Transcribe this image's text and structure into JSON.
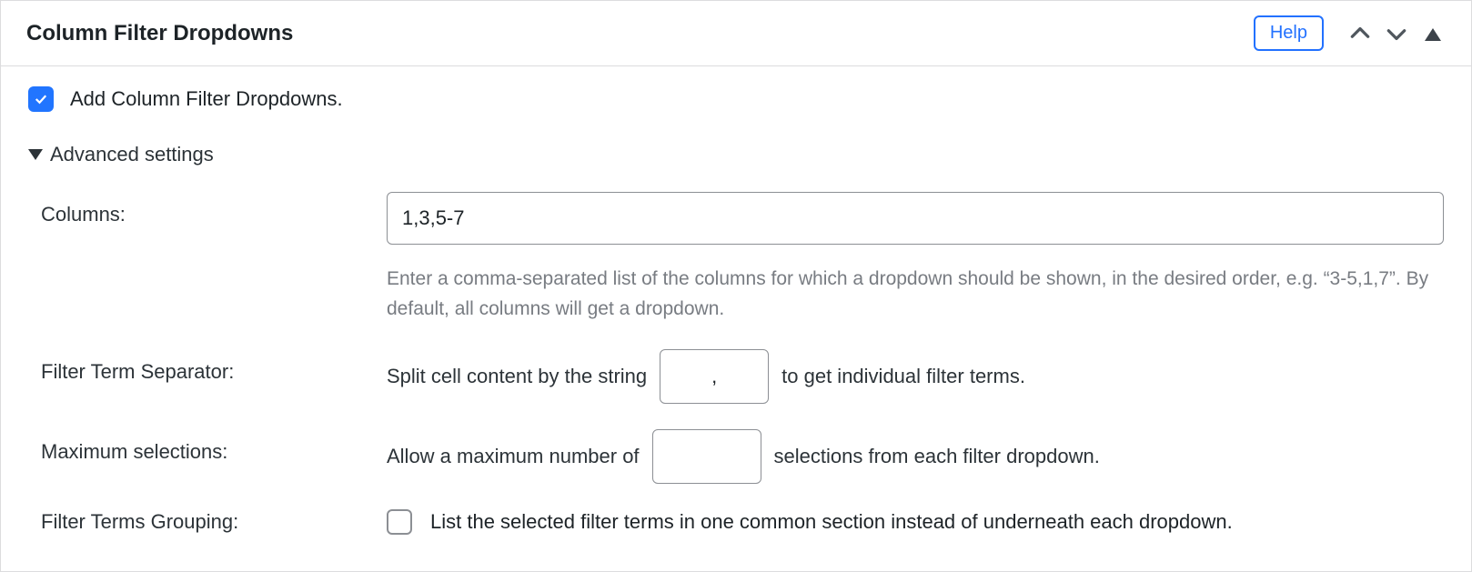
{
  "header": {
    "title": "Column Filter Dropdowns",
    "help_label": "Help"
  },
  "main": {
    "enable_checkbox_label": "Add Column Filter Dropdowns.",
    "advanced_label": "Advanced settings",
    "columns": {
      "label": "Columns:",
      "value": "1,3,5-7",
      "description": "Enter a comma-separated list of the columns for which a dropdown should be shown, in the desired order, e.g. “3-5,1,7”. By default, all columns will get a dropdown."
    },
    "separator": {
      "label": "Filter Term Separator:",
      "before": "Split cell content by the string",
      "value": ",",
      "after": "to get individual filter terms."
    },
    "max": {
      "label": "Maximum selections:",
      "before": "Allow a maximum number of",
      "value": "",
      "after": "selections from each filter dropdown."
    },
    "grouping": {
      "label": "Filter Terms Grouping:",
      "checkbox_label": "List the selected filter terms in one common section instead of underneath each dropdown."
    }
  }
}
